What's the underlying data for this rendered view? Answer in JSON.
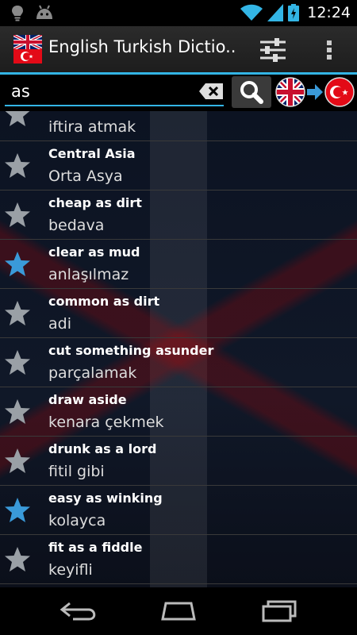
{
  "status": {
    "time": "12:24"
  },
  "actionbar": {
    "title": "English Turkish Dictio..."
  },
  "search": {
    "value": "as"
  },
  "entries": [
    {
      "en": "",
      "tr": "iftira atmak",
      "starred": false
    },
    {
      "en": "Central Asia",
      "tr": "Orta Asya",
      "starred": false
    },
    {
      "en": "cheap as dirt",
      "tr": "bedava",
      "starred": false
    },
    {
      "en": "clear as mud",
      "tr": "anlaşılmaz",
      "starred": true
    },
    {
      "en": "common as dirt",
      "tr": "adi",
      "starred": false
    },
    {
      "en": "cut something asunder",
      "tr": "parçalamak",
      "starred": false
    },
    {
      "en": "draw aside",
      "tr": "kenara çekmek",
      "starred": false
    },
    {
      "en": "drunk as a lord",
      "tr": "fitil gibi",
      "starred": false
    },
    {
      "en": "easy as winking",
      "tr": "kolayca",
      "starred": true
    },
    {
      "en": "fit as a fiddle",
      "tr": "keyifli",
      "starred": false
    }
  ],
  "colors": {
    "accent": "#33b5e5",
    "star_on": "#3a9ad9",
    "star_off": "#9aa0a6"
  }
}
